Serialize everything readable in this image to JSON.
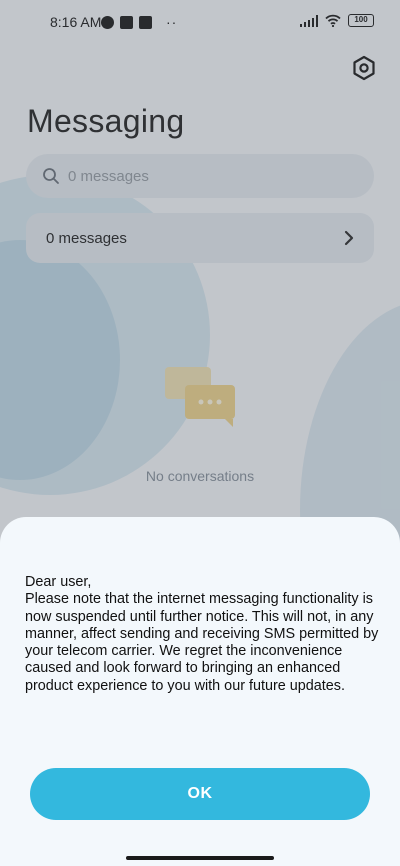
{
  "status_bar": {
    "time": "8:16 AM",
    "extra_indicator": "··",
    "battery": "100"
  },
  "app": {
    "title": "Messaging",
    "search_placeholder": "0 messages",
    "row_label": "0 messages",
    "empty_text": "No conversations"
  },
  "dialog": {
    "greeting": "Dear user,",
    "body": "Please note that the internet messaging functionality is now suspended until further notice. This will not, in any manner, affect sending and receiving SMS permitted by your telecom carrier. We regret the inconvenience caused and look forward to bringing an enhanced product experience to you with our future updates.",
    "ok_label": "OK"
  },
  "colors": {
    "accent": "#33b8de",
    "sheet_bg": "#f3f8fc"
  },
  "icons": [
    "settings-gear-icon",
    "search-icon",
    "chevron-right-icon",
    "chat-bubbles-icon",
    "wifi-icon",
    "signal-icon",
    "battery-icon"
  ]
}
